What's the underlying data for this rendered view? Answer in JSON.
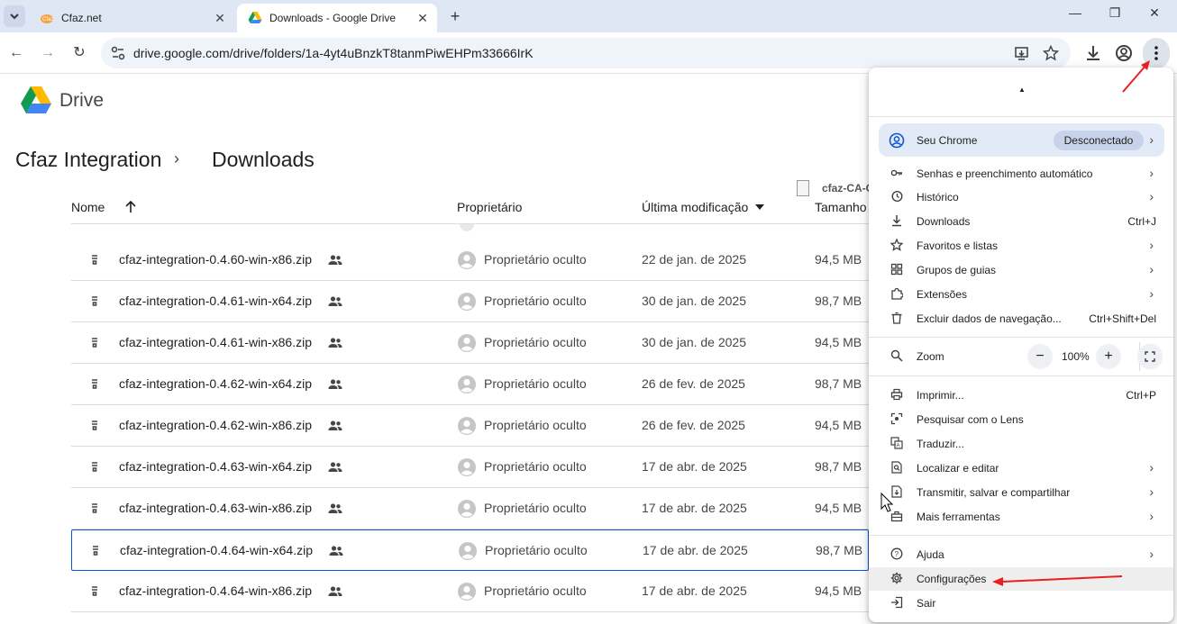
{
  "browser": {
    "tabs": [
      {
        "title": "Cfaz.net",
        "favicon": "cfaz-favicon",
        "active": false
      },
      {
        "title": "Downloads - Google Drive",
        "favicon": "drive-favicon",
        "active": true
      }
    ],
    "url": "drive.google.com/drive/folders/1a-4yt4uBnzkT8tanmPiwEHPm33666IrK"
  },
  "drive": {
    "app_name": "Drive",
    "breadcrumb": [
      "Cfaz Integration",
      "Downloads"
    ],
    "columns": {
      "name": "Nome",
      "owner": "Proprietário",
      "modified": "Última modificação",
      "size": "Tamanho"
    },
    "tooltip_file": "cfaz-CA-C",
    "files": [
      {
        "name": "cfaz-integration-0.4.60-win-x86.zip",
        "owner": "Proprietário oculto",
        "modified": "22 de jan. de 2025",
        "size": "94,5 MB"
      },
      {
        "name": "cfaz-integration-0.4.61-win-x64.zip",
        "owner": "Proprietário oculto",
        "modified": "30 de jan. de 2025",
        "size": "98,7 MB"
      },
      {
        "name": "cfaz-integration-0.4.61-win-x86.zip",
        "owner": "Proprietário oculto",
        "modified": "30 de jan. de 2025",
        "size": "94,5 MB"
      },
      {
        "name": "cfaz-integration-0.4.62-win-x64.zip",
        "owner": "Proprietário oculto",
        "modified": "26 de fev. de 2025",
        "size": "98,7 MB"
      },
      {
        "name": "cfaz-integration-0.4.62-win-x86.zip",
        "owner": "Proprietário oculto",
        "modified": "26 de fev. de 2025",
        "size": "94,5 MB"
      },
      {
        "name": "cfaz-integration-0.4.63-win-x64.zip",
        "owner": "Proprietário oculto",
        "modified": "17 de abr. de 2025",
        "size": "98,7 MB"
      },
      {
        "name": "cfaz-integration-0.4.63-win-x86.zip",
        "owner": "Proprietário oculto",
        "modified": "17 de abr. de 2025",
        "size": "94,5 MB"
      },
      {
        "name": "cfaz-integration-0.4.64-win-x64.zip",
        "owner": "Proprietário oculto",
        "modified": "17 de abr. de 2025",
        "size": "98,7 MB",
        "selected": true
      },
      {
        "name": "cfaz-integration-0.4.64-win-x86.zip",
        "owner": "Proprietário oculto",
        "modified": "17 de abr. de 2025",
        "size": "94,5 MB"
      }
    ]
  },
  "chrome_menu": {
    "profile": {
      "label": "Seu Chrome",
      "badge": "Desconectado"
    },
    "items": {
      "passwords": {
        "label": "Senhas e preenchimento automático"
      },
      "history": {
        "label": "Histórico"
      },
      "downloads": {
        "label": "Downloads",
        "shortcut": "Ctrl+J"
      },
      "bookmarks": {
        "label": "Favoritos e listas"
      },
      "tab_groups": {
        "label": "Grupos de guias"
      },
      "extensions": {
        "label": "Extensões"
      },
      "clear_data": {
        "label": "Excluir dados de navegação...",
        "shortcut": "Ctrl+Shift+Del"
      },
      "zoom": {
        "label": "Zoom",
        "value": "100%",
        "minus": "−",
        "plus": "+"
      },
      "print": {
        "label": "Imprimir...",
        "shortcut": "Ctrl+P"
      },
      "lens": {
        "label": "Pesquisar com o Lens"
      },
      "translate": {
        "label": "Traduzir..."
      },
      "find": {
        "label": "Localizar e editar"
      },
      "cast": {
        "label": "Transmitir, salvar e compartilhar"
      },
      "more_tools": {
        "label": "Mais ferramentas"
      },
      "help": {
        "label": "Ajuda"
      },
      "settings": {
        "label": "Configurações"
      },
      "exit": {
        "label": "Sair"
      }
    }
  },
  "colors": {
    "annotation_arrow": "#e8201f",
    "drive_blue": "#0b57d0"
  }
}
